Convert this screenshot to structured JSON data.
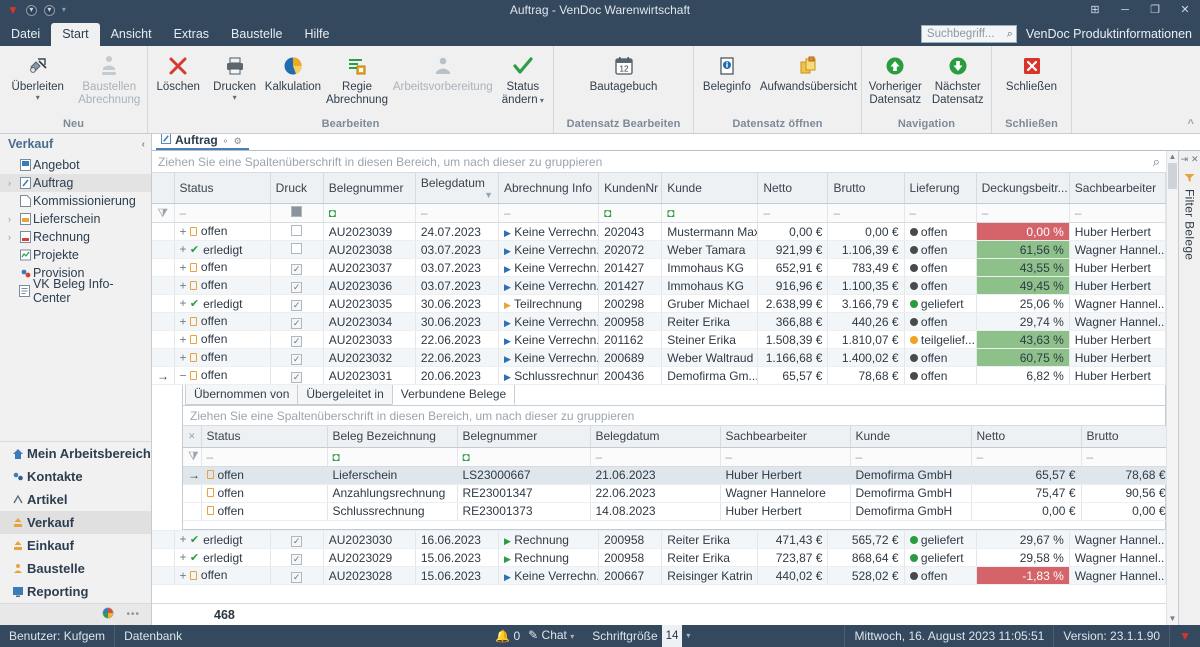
{
  "window": {
    "title": "Auftrag - VenDoc Warenwirtschaft",
    "quick_access": [
      "vendoc-logo-icon",
      "save-icon",
      "undo-icon",
      "customize-qat-icon"
    ],
    "buttons": [
      "restore-down-icon",
      "minimize-icon",
      "maximize-icon",
      "close-icon"
    ]
  },
  "menubar": {
    "items": [
      {
        "label": "Datei",
        "active": false
      },
      {
        "label": "Start",
        "active": true
      },
      {
        "label": "Ansicht",
        "active": false
      },
      {
        "label": "Extras",
        "active": false
      },
      {
        "label": "Baustelle",
        "active": false
      },
      {
        "label": "Hilfe",
        "active": false
      }
    ],
    "search_placeholder": "Suchbegriff...",
    "product_info": "VenDoc Produktinformationen"
  },
  "ribbon": {
    "groups": [
      {
        "label": "Neu",
        "buttons": [
          {
            "label": "Überleiten",
            "icon": "transfer-icon",
            "disabled": false,
            "caret": true
          },
          {
            "label": "Baustellen Abrechnung",
            "icon": "construction-billing-icon",
            "disabled": true,
            "caret": false
          }
        ]
      },
      {
        "label": "Bearbeiten",
        "buttons": [
          {
            "label": "Löschen",
            "icon": "delete-x-icon",
            "disabled": false,
            "caret": false
          },
          {
            "label": "Drucken",
            "icon": "printer-icon",
            "disabled": false,
            "caret": true
          },
          {
            "label": "Kalkulation",
            "icon": "pie-chart-icon",
            "disabled": false,
            "caret": false
          },
          {
            "label": "Regie Abrechnung",
            "icon": "list-billing-icon",
            "disabled": false,
            "caret": false
          },
          {
            "label": "Arbeitsvorbereitung",
            "icon": "work-preparation-icon",
            "disabled": true,
            "caret": false
          },
          {
            "label": "Status ändern",
            "icon": "green-check-icon",
            "disabled": false,
            "caret": true
          }
        ]
      },
      {
        "label": "Datensatz Bearbeiten",
        "buttons": [
          {
            "label": "Bautagebuch",
            "icon": "calendar-icon",
            "disabled": false,
            "caret": false
          }
        ]
      },
      {
        "label": "Datensatz öffnen",
        "buttons": [
          {
            "label": "Beleginfo",
            "icon": "document-info-icon",
            "disabled": false,
            "caret": false
          },
          {
            "label": "Aufwandsübersicht",
            "icon": "expense-overview-icon",
            "disabled": false,
            "caret": false
          }
        ]
      },
      {
        "label": "Navigation",
        "buttons": [
          {
            "label": "Vorheriger Datensatz",
            "icon": "arrow-up-circle-icon",
            "disabled": false,
            "caret": false
          },
          {
            "label": "Nächster Datensatz",
            "icon": "arrow-down-circle-icon",
            "disabled": false,
            "caret": false
          }
        ]
      },
      {
        "label": "Schließen",
        "buttons": [
          {
            "label": "Schließen",
            "icon": "close-red-icon",
            "disabled": false,
            "caret": false
          }
        ]
      }
    ],
    "collapse_icon": "^"
  },
  "sidebar": {
    "header": "Verkauf",
    "collapse_icon": "‹",
    "items": [
      {
        "label": "Angebot",
        "icon": "offer-doc-icon",
        "expandable": false,
        "selected": false
      },
      {
        "label": "Auftrag",
        "icon": "order-doc-icon",
        "expandable": true,
        "selected": true
      },
      {
        "label": "Kommissionierung",
        "icon": "picking-doc-icon",
        "expandable": false,
        "selected": false
      },
      {
        "label": "Lieferschein",
        "icon": "delivery-note-icon",
        "expandable": true,
        "selected": false
      },
      {
        "label": "Rechnung",
        "icon": "invoice-doc-icon",
        "expandable": true,
        "selected": false
      },
      {
        "label": "Projekte",
        "icon": "projects-icon",
        "expandable": false,
        "selected": false
      },
      {
        "label": "Provision",
        "icon": "commission-icon",
        "expandable": false,
        "selected": false
      },
      {
        "label": "VK Beleg Info-Center",
        "icon": "info-center-icon",
        "expandable": false,
        "selected": false
      }
    ],
    "modules": [
      {
        "label": "Mein Arbeitsbereich",
        "icon": "home-icon",
        "selected": false
      },
      {
        "label": "Kontakte",
        "icon": "contacts-icon",
        "selected": false
      },
      {
        "label": "Artikel",
        "icon": "article-icon",
        "selected": false
      },
      {
        "label": "Verkauf",
        "icon": "sales-icon",
        "selected": true
      },
      {
        "label": "Einkauf",
        "icon": "purchase-icon",
        "selected": false
      },
      {
        "label": "Baustelle",
        "icon": "construction-site-icon",
        "selected": false
      },
      {
        "label": "Reporting",
        "icon": "reporting-icon",
        "selected": false
      }
    ],
    "footer_icons": [
      "config-wheel-icon",
      "more-options-icon"
    ]
  },
  "document_tab": {
    "label": "Auftrag",
    "icon": "order-doc-icon",
    "pin_icon": "⚬",
    "close_icon": "✕"
  },
  "filter_panel": {
    "label": "Filter Belege",
    "icon": "filter-funnel-icon",
    "pin_icon": "⇥",
    "close_icon": "✕"
  },
  "main_grid": {
    "group_hint": "Ziehen Sie eine Spaltenüberschrift in diesen Bereich, um nach dieser zu gruppieren",
    "search_icon": "search-icon",
    "columns": [
      {
        "label": "Status",
        "align": "left"
      },
      {
        "label": "Druck",
        "align": "left"
      },
      {
        "label": "Belegnummer",
        "align": "left"
      },
      {
        "label": "Belegdatum",
        "align": "left",
        "sorted": true
      },
      {
        "label": "Abrechnung Info",
        "align": "left"
      },
      {
        "label": "KundenNr",
        "align": "left"
      },
      {
        "label": "Kunde",
        "align": "left"
      },
      {
        "label": "Netto",
        "align": "right"
      },
      {
        "label": "Brutto",
        "align": "right"
      },
      {
        "label": "Lieferung",
        "align": "left"
      },
      {
        "label": "Deckungsbeitr...",
        "align": "right"
      },
      {
        "label": "Sachbearbeiter",
        "align": "left"
      }
    ],
    "filter_row": [
      "–",
      "▪",
      "⌷",
      "–",
      "–",
      "⌷",
      "⌷",
      "–",
      "–",
      "–",
      "–",
      "–"
    ],
    "rows": [
      {
        "expand": "+",
        "status": "offen",
        "status_type": "open",
        "druck": false,
        "belegnummer": "AU2023039",
        "belegdatum": "24.07.2023",
        "abrechnung": "Keine Verrechn...",
        "abrechnung_color": "#2c6fb5",
        "kundennr": "202043",
        "kunde": "Mustermann Max",
        "netto": "0,00 €",
        "brutto": "0,00 €",
        "lieferung": "offen",
        "lieferung_color": "#4a4a4a",
        "db": "0,00 %",
        "db_bg": "#d4646a",
        "db_fg": "#ffffff",
        "sachbearbeiter": "Huber Herbert",
        "current": false,
        "selected": false
      },
      {
        "expand": "+",
        "status": "erledigt",
        "status_type": "done",
        "druck": false,
        "belegnummer": "AU2023038",
        "belegdatum": "03.07.2023",
        "abrechnung": "Keine Verrechn...",
        "abrechnung_color": "#2c6fb5",
        "kundennr": "202072",
        "kunde": "Weber Tamara",
        "netto": "921,99 €",
        "brutto": "1.106,39 €",
        "lieferung": "offen",
        "lieferung_color": "#4a4a4a",
        "db": "61,56 %",
        "db_bg": "#8ec08a",
        "db_fg": "#2b3642",
        "sachbearbeiter": "Wagner Hannel...",
        "current": false,
        "selected": false
      },
      {
        "expand": "+",
        "status": "offen",
        "status_type": "open",
        "druck": true,
        "belegnummer": "AU2023037",
        "belegdatum": "03.07.2023",
        "abrechnung": "Keine Verrechn...",
        "abrechnung_color": "#2c6fb5",
        "kundennr": "201427",
        "kunde": "Immohaus KG",
        "netto": "652,91 €",
        "brutto": "783,49 €",
        "lieferung": "offen",
        "lieferung_color": "#4a4a4a",
        "db": "43,55 %",
        "db_bg": "#8ec08a",
        "db_fg": "#2b3642",
        "sachbearbeiter": "Huber Herbert",
        "current": false,
        "selected": false
      },
      {
        "expand": "+",
        "status": "offen",
        "status_type": "open",
        "druck": true,
        "belegnummer": "AU2023036",
        "belegdatum": "03.07.2023",
        "abrechnung": "Keine Verrechn...",
        "abrechnung_color": "#2c6fb5",
        "kundennr": "201427",
        "kunde": "Immohaus KG",
        "netto": "916,96 €",
        "brutto": "1.100,35 €",
        "lieferung": "offen",
        "lieferung_color": "#4a4a4a",
        "db": "49,45 %",
        "db_bg": "#8ec08a",
        "db_fg": "#2b3642",
        "sachbearbeiter": "Huber Herbert",
        "current": false,
        "selected": false
      },
      {
        "expand": "+",
        "status": "erledigt",
        "status_type": "done",
        "druck": true,
        "belegnummer": "AU2023035",
        "belegdatum": "30.06.2023",
        "abrechnung": "Teilrechnung",
        "abrechnung_color": "#e8a33d",
        "kundennr": "200298",
        "kunde": "Gruber Michael",
        "netto": "2.638,99 €",
        "brutto": "3.166,79 €",
        "lieferung": "geliefert",
        "lieferung_color": "#2a9b3f",
        "db": "25,06 %",
        "db_bg": "transparent",
        "db_fg": "#2b3642",
        "sachbearbeiter": "Wagner Hannel...",
        "current": false,
        "selected": false
      },
      {
        "expand": "+",
        "status": "offen",
        "status_type": "open",
        "druck": true,
        "belegnummer": "AU2023034",
        "belegdatum": "30.06.2023",
        "abrechnung": "Keine Verrechn...",
        "abrechnung_color": "#2c6fb5",
        "kundennr": "200958",
        "kunde": "Reiter Erika",
        "netto": "366,88 €",
        "brutto": "440,26 €",
        "lieferung": "offen",
        "lieferung_color": "#4a4a4a",
        "db": "29,74 %",
        "db_bg": "transparent",
        "db_fg": "#2b3642",
        "sachbearbeiter": "Wagner Hannel...",
        "current": false,
        "selected": false
      },
      {
        "expand": "+",
        "status": "offen",
        "status_type": "open",
        "druck": true,
        "belegnummer": "AU2023033",
        "belegdatum": "22.06.2023",
        "abrechnung": "Keine Verrechn...",
        "abrechnung_color": "#2c6fb5",
        "kundennr": "201162",
        "kunde": "Steiner Erika",
        "netto": "1.508,39 €",
        "brutto": "1.810,07 €",
        "lieferung": "teilgelief...",
        "lieferung_color": "#f0a222",
        "db": "43,63 %",
        "db_bg": "#8ec08a",
        "db_fg": "#2b3642",
        "sachbearbeiter": "Huber Herbert",
        "current": false,
        "selected": false
      },
      {
        "expand": "+",
        "status": "offen",
        "status_type": "open",
        "druck": true,
        "belegnummer": "AU2023032",
        "belegdatum": "22.06.2023",
        "abrechnung": "Keine Verrechn...",
        "abrechnung_color": "#2c6fb5",
        "kundennr": "200689",
        "kunde": "Weber Waltraud",
        "netto": "1.166,68 €",
        "brutto": "1.400,02 €",
        "lieferung": "offen",
        "lieferung_color": "#4a4a4a",
        "db": "60,75 %",
        "db_bg": "#8ec08a",
        "db_fg": "#2b3642",
        "sachbearbeiter": "Huber Herbert",
        "current": false,
        "selected": false
      },
      {
        "expand": "−",
        "status": "offen",
        "status_type": "open",
        "druck": true,
        "belegnummer": "AU2023031",
        "belegdatum": "20.06.2023",
        "abrechnung": "Schlussrechnung",
        "abrechnung_color": "#2c6fb5",
        "kundennr": "200436",
        "kunde": "Demofirma Gm...",
        "netto": "65,57 €",
        "brutto": "78,68 €",
        "lieferung": "offen",
        "lieferung_color": "#4a4a4a",
        "db": "6,82 %",
        "db_bg": "transparent",
        "db_fg": "#2b3642",
        "sachbearbeiter": "Huber Herbert",
        "current": true,
        "selected": false
      }
    ],
    "rows_after": [
      {
        "expand": "+",
        "status": "erledigt",
        "status_type": "done",
        "druck": true,
        "belegnummer": "AU2023030",
        "belegdatum": "16.06.2023",
        "abrechnung": "Rechnung",
        "abrechnung_color": "#2a9b3f",
        "kundennr": "200958",
        "kunde": "Reiter Erika",
        "netto": "471,43 €",
        "brutto": "565,72 €",
        "lieferung": "geliefert",
        "lieferung_color": "#2a9b3f",
        "db": "29,67 %",
        "db_bg": "transparent",
        "db_fg": "#2b3642",
        "sachbearbeiter": "Wagner Hannel...",
        "current": false,
        "selected": false
      },
      {
        "expand": "+",
        "status": "erledigt",
        "status_type": "done",
        "druck": true,
        "belegnummer": "AU2023029",
        "belegdatum": "15.06.2023",
        "abrechnung": "Rechnung",
        "abrechnung_color": "#2a9b3f",
        "kundennr": "200958",
        "kunde": "Reiter Erika",
        "netto": "723,87 €",
        "brutto": "868,64 €",
        "lieferung": "geliefert",
        "lieferung_color": "#2a9b3f",
        "db": "29,58 %",
        "db_bg": "transparent",
        "db_fg": "#2b3642",
        "sachbearbeiter": "Wagner Hannel...",
        "current": false,
        "selected": false
      },
      {
        "expand": "+",
        "status": "offen",
        "status_type": "open",
        "druck": true,
        "belegnummer": "AU2023028",
        "belegdatum": "15.06.2023",
        "abrechnung": "Keine Verrechn...",
        "abrechnung_color": "#2c6fb5",
        "kundennr": "200667",
        "kunde": "Reisinger Katrin",
        "netto": "440,02 €",
        "brutto": "528,02 €",
        "lieferung": "offen",
        "lieferung_color": "#4a4a4a",
        "db": "-1,83 %",
        "db_bg": "#d4646a",
        "db_fg": "#ffffff",
        "sachbearbeiter": "Wagner Hannel...",
        "current": false,
        "selected": false
      }
    ],
    "record_count": "468"
  },
  "detail_grid": {
    "tabs": [
      {
        "label": "Übernommen von",
        "active": false
      },
      {
        "label": "Übergeleitet in",
        "active": false
      },
      {
        "label": "Verbundene Belege",
        "active": true
      }
    ],
    "group_hint": "Ziehen Sie eine Spaltenüberschrift in diesen Bereich, um nach dieser zu gruppieren",
    "columns": [
      {
        "label": "Status",
        "align": "left"
      },
      {
        "label": "Beleg Bezeichnung",
        "align": "left"
      },
      {
        "label": "Belegnummer",
        "align": "left"
      },
      {
        "label": "Belegdatum",
        "align": "left"
      },
      {
        "label": "Sachbearbeiter",
        "align": "left"
      },
      {
        "label": "Kunde",
        "align": "left"
      },
      {
        "label": "Netto",
        "align": "right"
      },
      {
        "label": "Brutto",
        "align": "right"
      }
    ],
    "filter_row": [
      "–",
      "⌷",
      "⌷",
      "–",
      "–",
      "–",
      "–",
      "–"
    ],
    "rows": [
      {
        "status": "offen",
        "bezeichnung": "Lieferschein",
        "belegnummer": "LS23000667",
        "belegdatum": "21.06.2023",
        "sachbearbeiter": "Huber Herbert",
        "kunde": "Demofirma GmbH",
        "netto": "65,57 €",
        "brutto": "78,68 €",
        "current": true
      },
      {
        "status": "offen",
        "bezeichnung": "Anzahlungsrechnung",
        "belegnummer": "RE23001347",
        "belegdatum": "22.06.2023",
        "sachbearbeiter": "Wagner Hannelore",
        "kunde": "Demofirma GmbH",
        "netto": "75,47 €",
        "brutto": "90,56 €",
        "current": false
      },
      {
        "status": "offen",
        "bezeichnung": "Schlussrechnung",
        "belegnummer": "RE23001373",
        "belegdatum": "14.08.2023",
        "sachbearbeiter": "Huber Herbert",
        "kunde": "Demofirma GmbH",
        "netto": "0,00 €",
        "brutto": "0,00 €",
        "current": false
      }
    ]
  },
  "statusbar": {
    "user": "Benutzer: Kufgem",
    "database": "Datenbank",
    "notifications": "0",
    "notification_icon": "bell-icon",
    "chat": "Chat",
    "chat_icon": "chat-icon",
    "fontsize_label": "Schriftgröße",
    "fontsize_value": "14",
    "datetime": "Mittwoch, 16. August 2023 11:05:51",
    "version": "Version: 23.1.1.90",
    "logo_icon": "vendoc-logo-icon"
  },
  "colors": {
    "chrome": "#34495e",
    "ribbon_bg": "#f0f0f0",
    "accent_blue": "#4a7fb5",
    "green": "#2a9b3f",
    "orange": "#e8a33d",
    "red": "#d9342b",
    "db_green": "#8ec08a",
    "db_red": "#d4646a"
  }
}
